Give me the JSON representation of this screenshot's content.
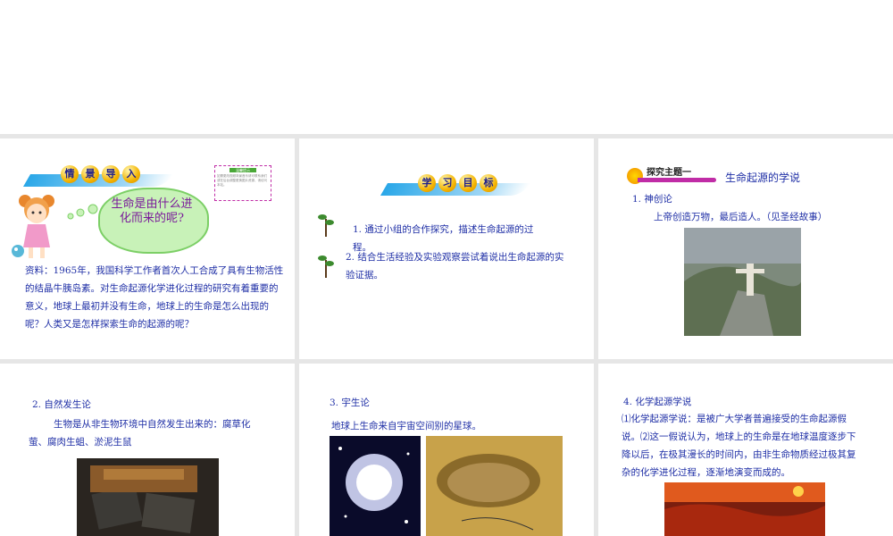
{
  "slide1": {
    "banner": [
      "情",
      "景",
      "导",
      "入"
    ],
    "note_title": "温馨提示",
    "note_text": "如需更改视频背景音乐请可联系我们或在后台调整更换图片资源，请访问本站。",
    "bubble_text": "生命是由什么进化而来的呢?",
    "paragraph": "资料：1965年，我国科学工作者首次人工合成了具有生物活性的结晶牛胰岛素。对生命起源化学进化过程的研究有着重要的意义，地球上最初并没有生命，地球上的生命是怎么出现的呢？人类又是怎样探索生命的起源的呢？"
  },
  "slide2": {
    "banner": [
      "学",
      "习",
      "目",
      "标"
    ],
    "goal1": "1. 通过小组的合作探究，描述生命起源的过程。",
    "goal2": "2. 结合生活经验及实验观察尝试着说出生命起源的实验证据。"
  },
  "slide3": {
    "tag": "探究主题一",
    "title": "生命起源的学说",
    "heading": "1. 神创论",
    "text": "上帝创造万物，最后造人。（见圣经故事）"
  },
  "slide4": {
    "heading": "2. 自然发生论",
    "text": "生物是从非生物环境中自然发生出来的：腐草化萤、腐肉生蛆、淤泥生鼠"
  },
  "slide5": {
    "heading": "3. 宇生论",
    "text": "地球上生命来自宇宙空间别的星球。"
  },
  "slide6": {
    "heading": "4. 化学起源学说",
    "text": "⑴化学起源学说：是被广大学者普遍接受的生命起源假说。⑵这一假说认为，地球上的生命是在地球温度逐步下降以后，在极其漫长的时间内，由非生命物质经过极其复杂的化学进化过程，逐渐地演变而成的。"
  }
}
